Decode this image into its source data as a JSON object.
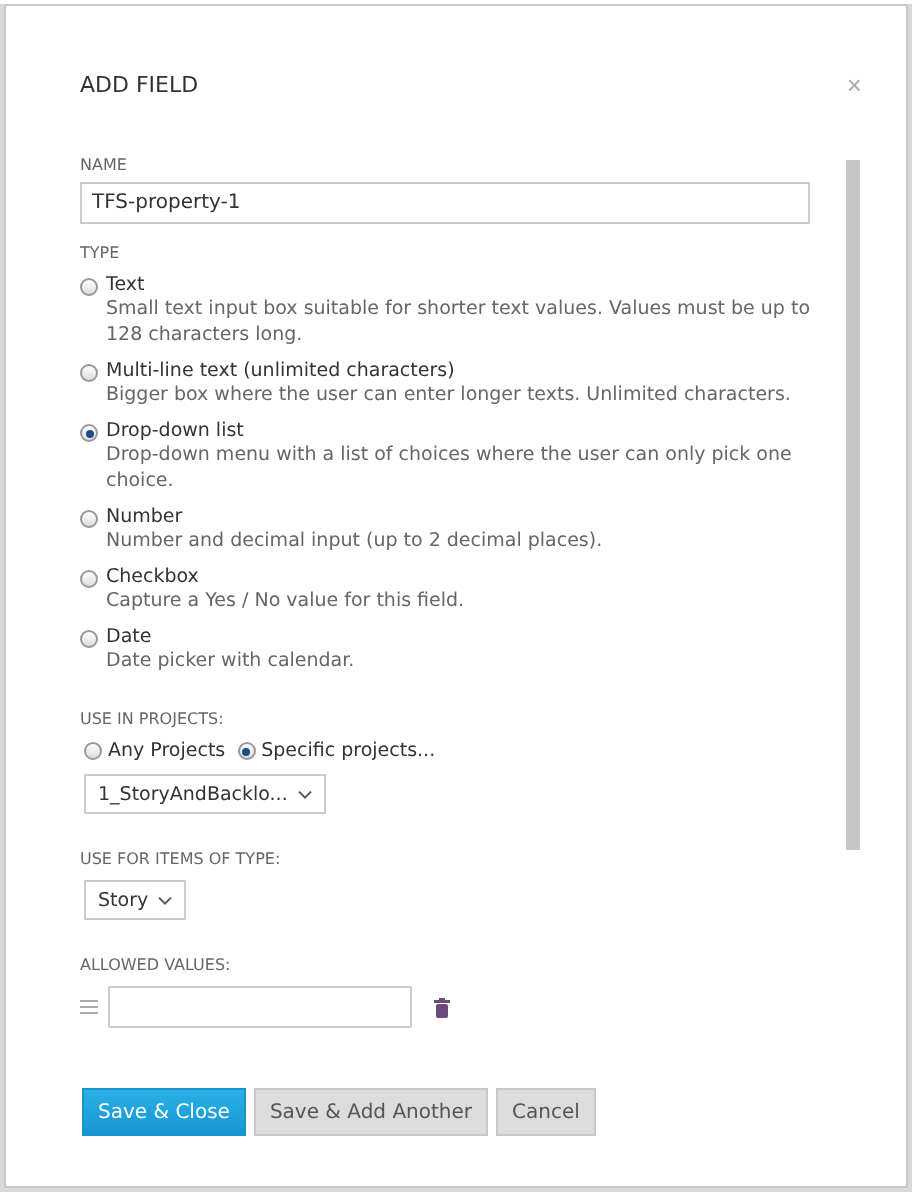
{
  "dialog": {
    "title": "ADD FIELD",
    "close": "×"
  },
  "name": {
    "label": "NAME",
    "value": "TFS-property-1"
  },
  "type": {
    "label": "TYPE",
    "options": [
      {
        "label": "Text",
        "description": "Small text input box suitable for shorter text values. Values must be up to 128 characters long.",
        "selected": false
      },
      {
        "label": "Multi-line text (unlimited characters)",
        "description": "Bigger box where the user can enter longer texts. Unlimited characters.",
        "selected": false
      },
      {
        "label": "Drop-down list",
        "description": "Drop-down menu with a list of choices where the user can only pick one choice.",
        "selected": true
      },
      {
        "label": "Number",
        "description": "Number and decimal input (up to 2 decimal places).",
        "selected": false
      },
      {
        "label": "Checkbox",
        "description": "Capture a Yes / No value for this field.",
        "selected": false
      },
      {
        "label": "Date",
        "description": "Date picker with calendar.",
        "selected": false
      }
    ]
  },
  "projects": {
    "label": "USE IN PROJECTS:",
    "options": [
      {
        "label": "Any Projects",
        "selected": false
      },
      {
        "label": "Specific projects...",
        "selected": true
      }
    ],
    "dropdown": "1_StoryAndBacklo..."
  },
  "item_type": {
    "label": "USE FOR ITEMS OF TYPE:",
    "dropdown": "Story"
  },
  "allowed_values": {
    "label": "ALLOWED VALUES:"
  },
  "buttons": [
    {
      "label": "Save & Close",
      "kind": "primary"
    },
    {
      "label": "Save & Add Another",
      "kind": "secondary"
    },
    {
      "label": "Cancel",
      "kind": "secondary"
    }
  ]
}
